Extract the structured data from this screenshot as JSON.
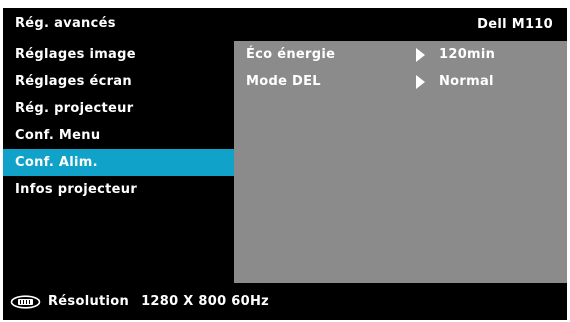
{
  "header": {
    "title": "Rég. avancés",
    "model": "Dell  M110"
  },
  "menu": {
    "items": [
      {
        "label": "Réglages image",
        "active": false
      },
      {
        "label": "Réglages écran",
        "active": false
      },
      {
        "label": "Rég. projecteur",
        "active": false
      },
      {
        "label": "Conf. Menu",
        "active": false
      },
      {
        "label": "Conf. Alim.",
        "active": true
      },
      {
        "label": "Infos projecteur",
        "active": false
      }
    ]
  },
  "settings": {
    "rows": [
      {
        "name": "Éco énergie",
        "value": "120min"
      },
      {
        "name": "Mode DEL",
        "value": "Normal"
      }
    ]
  },
  "status": {
    "icon": "input-source-icon",
    "label": "Résolution",
    "value": "1280 X 800 60Hz"
  },
  "colors": {
    "background": "#000000",
    "active_item": "#11a2ca",
    "right_panel": "#8b8b8b",
    "text": "#ffffff"
  }
}
